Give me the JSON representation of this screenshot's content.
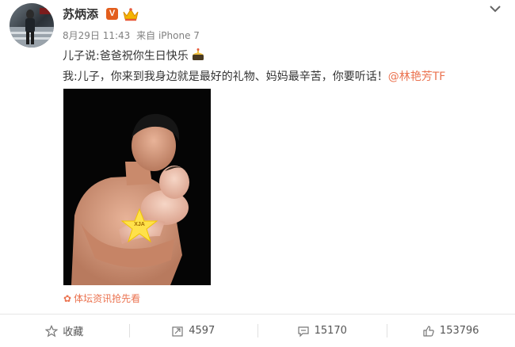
{
  "post": {
    "author": "苏炳添",
    "verified_badge": "V",
    "meta_date": "8月29日 11:43",
    "meta_from": "来自 iPhone 7",
    "text_line1": "儿子说:爸爸祝你生日快乐",
    "text_line2_main": "我:儿子，你来到我身边就是最好的礼物、妈妈最辛苦，你要听话！",
    "mention": "@林艳芳TF",
    "source_tag": "体坛资讯抢先看",
    "sticker_text": "XJA"
  },
  "actions": {
    "favorite_label": "收藏",
    "repost_count": "4597",
    "comment_count": "15170",
    "like_count": "153796"
  },
  "colors": {
    "accent": "#eb7350",
    "badge": "#e35e1d",
    "text": "#333333",
    "meta": "#808080"
  },
  "icons": [
    "more-icon",
    "star-icon",
    "repost-icon",
    "comment-icon",
    "like-icon",
    "crown-icon",
    "flower-icon"
  ]
}
